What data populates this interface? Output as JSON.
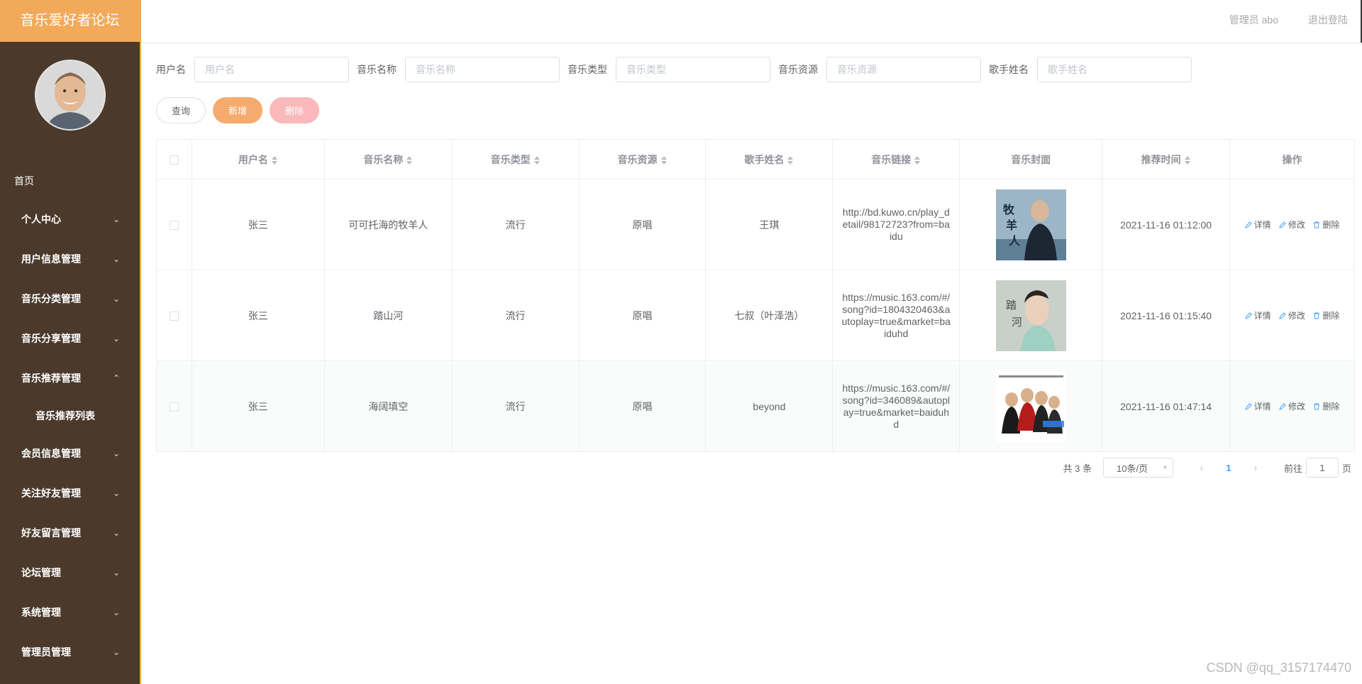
{
  "app": {
    "title": "音乐爱好者论坛",
    "user_label": "管理员 abo",
    "logout_label": "退出登陆"
  },
  "sidebar": {
    "home": "首页",
    "menus": [
      {
        "label": "个人中心",
        "expanded": false
      },
      {
        "label": "用户信息管理",
        "expanded": false
      },
      {
        "label": "音乐分类管理",
        "expanded": false
      },
      {
        "label": "音乐分享管理",
        "expanded": false
      },
      {
        "label": "音乐推荐管理",
        "expanded": true
      },
      {
        "label": "音乐推荐列表",
        "sub": true
      },
      {
        "label": "会员信息管理",
        "expanded": false
      },
      {
        "label": "关注好友管理",
        "expanded": false
      },
      {
        "label": "好友留言管理",
        "expanded": false
      },
      {
        "label": "论坛管理",
        "expanded": false
      },
      {
        "label": "系统管理",
        "expanded": false
      },
      {
        "label": "管理员管理",
        "expanded": false
      }
    ],
    "chevron_down": "⌄",
    "chevron_up": "⌃"
  },
  "search": {
    "fields": [
      {
        "label": "用户名",
        "placeholder": "用户名",
        "value": ""
      },
      {
        "label": "音乐名称",
        "placeholder": "音乐名称",
        "value": ""
      },
      {
        "label": "音乐类型",
        "placeholder": "音乐类型",
        "value": ""
      },
      {
        "label": "音乐资源",
        "placeholder": "音乐资源",
        "value": ""
      },
      {
        "label": "歌手姓名",
        "placeholder": "歌手姓名",
        "value": ""
      }
    ],
    "query_label": "查询",
    "add_label": "新增",
    "delete_label": "删除"
  },
  "table": {
    "headers": [
      "用户名",
      "音乐名称",
      "音乐类型",
      "音乐资源",
      "歌手姓名",
      "音乐链接",
      "音乐封面",
      "推荐时间",
      "操作"
    ],
    "rows": [
      {
        "username": "张三",
        "music_name": "可可托海的牧羊人",
        "music_type": "流行",
        "resource": "原唱",
        "singer": "王琪",
        "link": "http://bd.kuwo.cn/play_detail/98172723?from=baidu",
        "time": "2021-11-16 01:12:00"
      },
      {
        "username": "张三",
        "music_name": "踏山河",
        "music_type": "流行",
        "resource": "原唱",
        "singer": "七叔（叶泽浩）",
        "link": "https://music.163.com/#/song?id=1804320463&autoplay=true&market=baiduhd",
        "time": "2021-11-16 01:15:40"
      },
      {
        "username": "张三",
        "music_name": "海阔填空",
        "music_type": "流行",
        "resource": "原唱",
        "singer": "beyond",
        "link": "https://music.163.com/#/song?id=346089&autoplay=true&market=baiduhd",
        "time": "2021-11-16 01:47:14"
      }
    ],
    "actions": {
      "detail": "详情",
      "edit": "修改",
      "delete": "删除"
    }
  },
  "pagination": {
    "total_label": "共 3 条",
    "page_size_label": "10条/页",
    "current_page": "1",
    "goto_prefix": "前往",
    "goto_value": "1",
    "goto_suffix": "页",
    "prev_icon": "‹",
    "next_icon": "›"
  },
  "watermark": "CSDN @qq_3157174470",
  "colors": {
    "sidebar_bg": "#4b3a2c",
    "brand_bg": "#f2a959",
    "link_blue": "#409eff",
    "add_button": "#f5ab6e",
    "delete_button": "#f9b9bb"
  }
}
